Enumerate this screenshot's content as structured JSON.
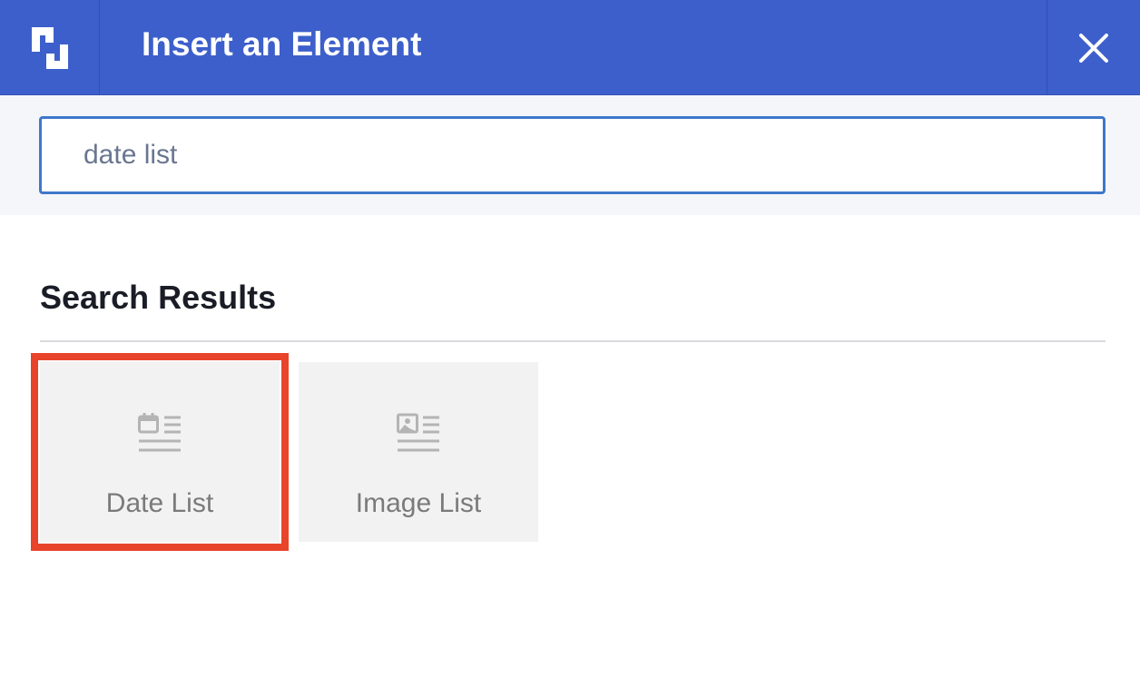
{
  "header": {
    "logo": "brand-logo-icon",
    "title": "Insert an Element",
    "close_icon": "close-icon",
    "background_color": "#3d5fcb"
  },
  "search": {
    "value": "date list",
    "placeholder": ""
  },
  "results": {
    "heading": "Search Results",
    "items": [
      {
        "label": "Date List",
        "icon": "date-list-icon",
        "selected": true
      },
      {
        "label": "Image List",
        "icon": "image-list-icon",
        "selected": false
      }
    ]
  },
  "colors": {
    "selection_outline": "#e8432b",
    "input_border": "#3e78c9"
  }
}
